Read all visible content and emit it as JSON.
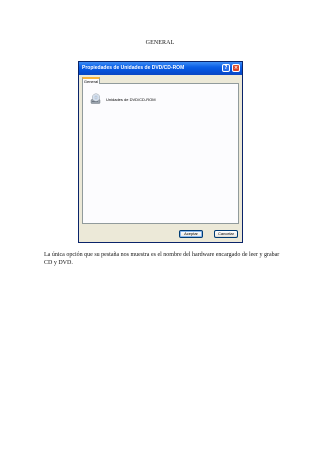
{
  "document": {
    "heading": "GENERAL",
    "paragraph": "La única opción que su pestaña nos muestra es el nombre del hardware encargado de leer y grabar CD y DVD."
  },
  "dialog": {
    "title": "Propiedades de Unidades de DVD/CD-ROM",
    "help_button": "?",
    "close_button": "×",
    "tabs": [
      {
        "label": "General",
        "selected": true
      }
    ],
    "device": {
      "icon": "cd-drive-icon",
      "label": "Unidades de DVD/CD-ROM"
    },
    "buttons": {
      "ok": "Aceptar",
      "cancel": "Cancelar"
    }
  },
  "colors": {
    "titlebar": "#0a5ee6",
    "dialog_background": "#ece9d8",
    "tab_highlight": "#f8b33a",
    "close_button": "#d9472b"
  }
}
